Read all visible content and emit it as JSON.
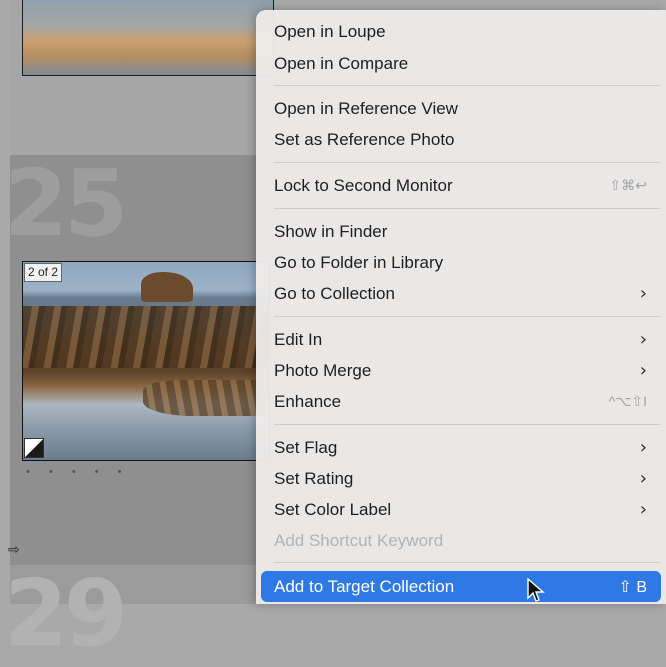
{
  "grid": {
    "cell_number_top": "25",
    "cell_number_bottom": "29",
    "photo_badge": "2 of 2",
    "rating_dots": "• • • • •",
    "badge_icon": "arrow-right-icon",
    "arrow_glyph": "⇨"
  },
  "menu": {
    "items": [
      {
        "label": "Open in Loupe",
        "shortcut": "",
        "submenu": false,
        "enabled": true
      },
      {
        "label": "Open in Compare",
        "shortcut": "",
        "submenu": false,
        "enabled": true
      },
      {
        "label": "Open in Reference View",
        "shortcut": "",
        "submenu": false,
        "enabled": true
      },
      {
        "label": "Set as Reference Photo",
        "shortcut": "",
        "submenu": false,
        "enabled": true
      },
      {
        "label": "Lock to Second Monitor",
        "shortcut": "⇧⌘↩",
        "submenu": false,
        "enabled": true
      },
      {
        "label": "Show in Finder",
        "shortcut": "",
        "submenu": false,
        "enabled": true
      },
      {
        "label": "Go to Folder in Library",
        "shortcut": "",
        "submenu": false,
        "enabled": true
      },
      {
        "label": "Go to Collection",
        "shortcut": "",
        "submenu": true,
        "enabled": true
      },
      {
        "label": "Edit In",
        "shortcut": "",
        "submenu": true,
        "enabled": true
      },
      {
        "label": "Photo Merge",
        "shortcut": "",
        "submenu": true,
        "enabled": true
      },
      {
        "label": "Enhance",
        "shortcut": "^⌥⇧I",
        "submenu": false,
        "enabled": true
      },
      {
        "label": "Set Flag",
        "shortcut": "",
        "submenu": true,
        "enabled": true
      },
      {
        "label": "Set Rating",
        "shortcut": "",
        "submenu": true,
        "enabled": true
      },
      {
        "label": "Set Color Label",
        "shortcut": "",
        "submenu": true,
        "enabled": true
      },
      {
        "label": "Add Shortcut Keyword",
        "shortcut": "",
        "submenu": false,
        "enabled": false
      },
      {
        "label": "Add to Target Collection",
        "shortcut": "⇧ B",
        "submenu": false,
        "enabled": true,
        "highlighted": true
      }
    ],
    "chevron": "›"
  },
  "colors": {
    "highlight": "#2e79e6",
    "menu_bg": "#eceae9"
  }
}
